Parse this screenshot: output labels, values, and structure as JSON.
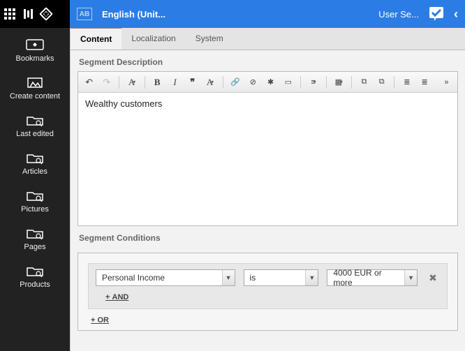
{
  "topbar": {
    "lang_badge": "AB",
    "title": "English (Unit...",
    "user": "User Se..."
  },
  "rail": {
    "items": [
      {
        "label": "Bookmarks"
      },
      {
        "label": "Create content"
      },
      {
        "label": "Last edited"
      },
      {
        "label": "Articles"
      },
      {
        "label": "Pictures"
      },
      {
        "label": "Pages"
      },
      {
        "label": "Products"
      }
    ]
  },
  "tabs": {
    "content": "Content",
    "localization": "Localization",
    "system": "System"
  },
  "sections": {
    "description": "Segment Description",
    "conditions": "Segment Conditions"
  },
  "editor": {
    "text": "Wealthy customers"
  },
  "condition": {
    "field": "Personal Income",
    "operator": "is",
    "value": "4000 EUR or more",
    "add_and": "AND",
    "add_or": "OR",
    "plus": "+"
  }
}
